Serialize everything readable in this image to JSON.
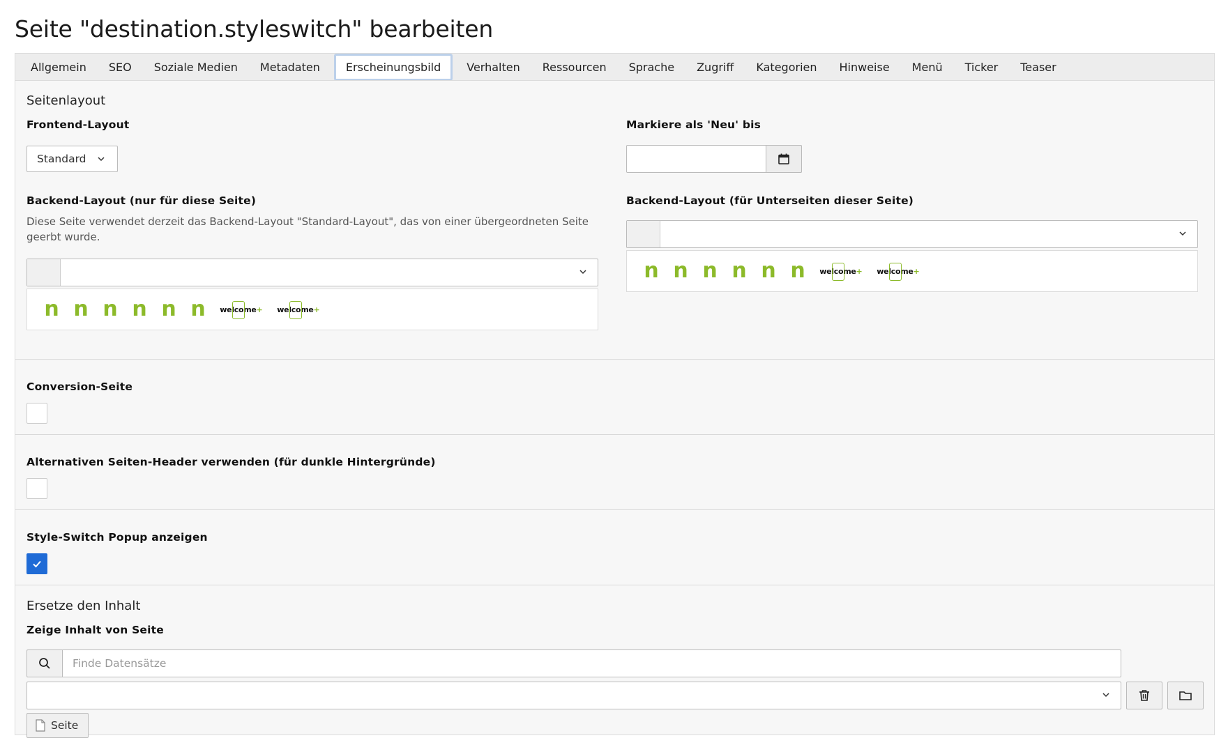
{
  "page": {
    "title": "Seite \"destination.styleswitch\" bearbeiten"
  },
  "tabs": [
    {
      "label": "Allgemein"
    },
    {
      "label": "SEO"
    },
    {
      "label": "Soziale Medien"
    },
    {
      "label": "Metadaten"
    },
    {
      "label": "Erscheinungsbild",
      "active": true
    },
    {
      "label": "Verhalten"
    },
    {
      "label": "Ressourcen"
    },
    {
      "label": "Sprache"
    },
    {
      "label": "Zugriff"
    },
    {
      "label": "Kategorien"
    },
    {
      "label": "Hinweise"
    },
    {
      "label": "Menü"
    },
    {
      "label": "Ticker"
    },
    {
      "label": "Teaser"
    }
  ],
  "layout_section": {
    "heading": "Seitenlayout",
    "frontend_layout": {
      "label": "Frontend-Layout",
      "value": "Standard"
    },
    "new_until": {
      "label": "Markiere als 'Neu' bis",
      "value": ""
    },
    "backend_layout_this": {
      "label": "Backend-Layout (nur für diese Seite)",
      "description": "Diese Seite verwendet derzeit das Backend-Layout \"Standard-Layout\", das von einer übergeordneten Seite geerbt wurde.",
      "value": ""
    },
    "backend_layout_sub": {
      "label": "Backend-Layout (für Unterseiten dieser Seite)",
      "value": ""
    },
    "thumbnails": {
      "n_glyph": "n",
      "welcome_text": "welcome",
      "welcome_plus": "+"
    }
  },
  "conversion": {
    "label": "Conversion-Seite",
    "checked": false
  },
  "alt_header": {
    "label": "Alternativen Seiten-Header verwenden (für dunkle Hintergründe)",
    "checked": false
  },
  "style_switch": {
    "label": "Style-Switch Popup anzeigen",
    "checked": true
  },
  "replace_content": {
    "heading": "Ersetze den Inhalt",
    "label": "Zeige Inhalt von Seite",
    "search_placeholder": "Finde Datensätze",
    "page_button": "Seite"
  },
  "colors": {
    "accent_green": "#8cba2a",
    "checkbox_blue": "#1f6bd6"
  },
  "icons": [
    "chevron-down-icon",
    "calendar-icon",
    "search-icon",
    "trash-icon",
    "folder-icon",
    "document-icon",
    "checkmark-icon"
  ]
}
